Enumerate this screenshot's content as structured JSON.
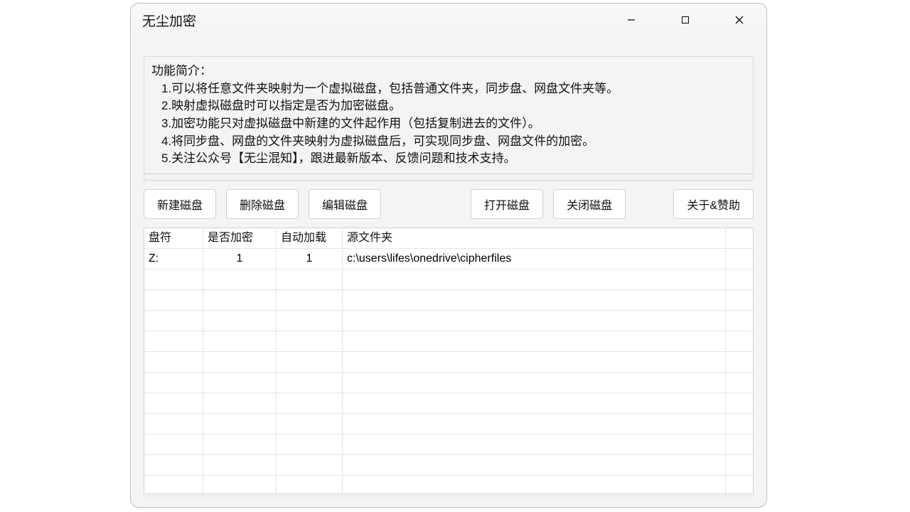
{
  "window": {
    "title": "无尘加密"
  },
  "intro": {
    "heading": "功能简介：",
    "lines": [
      "1.可以将任意文件夹映射为一个虚拟磁盘，包括普通文件夹，同步盘、网盘文件夹等。",
      "2.映射虚拟磁盘时可以指定是否为加密磁盘。",
      "3.加密功能只对虚拟磁盘中新建的文件起作用（包括复制进去的文件）。",
      "4.将同步盘、网盘的文件夹映射为虚拟磁盘后，可实现同步盘、网盘文件的加密。",
      "5.关注公众号【无尘混知】，跟进最新版本、反馈问题和技术支持。"
    ]
  },
  "toolbar": {
    "new_disk": "新建磁盘",
    "delete_disk": "删除磁盘",
    "edit_disk": "编辑磁盘",
    "open_disk": "打开磁盘",
    "close_disk": "关闭磁盘",
    "about": "关于&赞助"
  },
  "grid": {
    "columns": {
      "drive": "盘符",
      "encrypted": "是否加密",
      "autoload": "自动加载",
      "source": "源文件夹"
    },
    "rows": [
      {
        "drive": "Z:",
        "encrypted": "1",
        "autoload": "1",
        "source": "c:\\users\\lifes\\onedrive\\cipherfiles"
      }
    ]
  }
}
